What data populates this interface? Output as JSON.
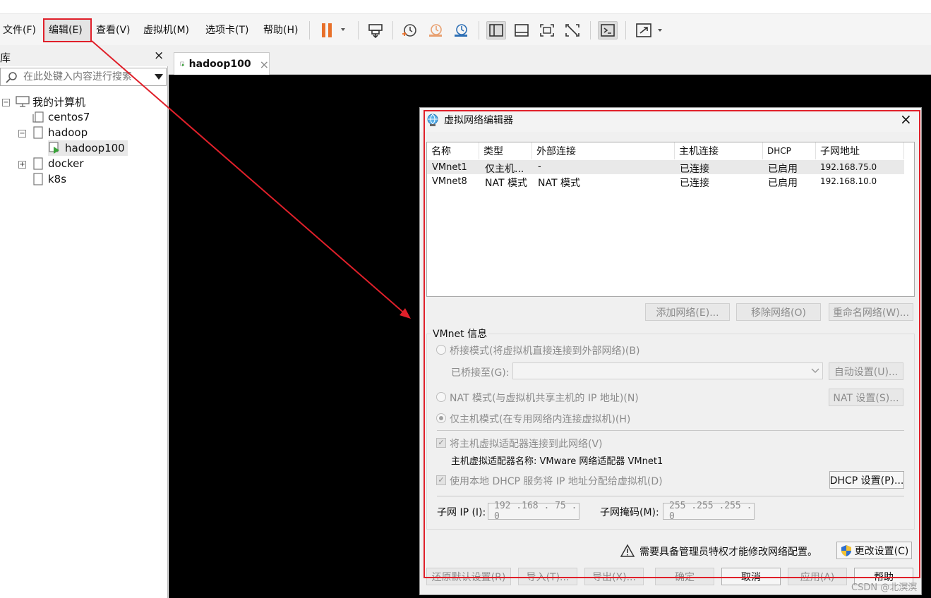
{
  "menu": {
    "file": "文件(F)",
    "edit": "编辑(E)",
    "view": "查看(V)",
    "vm": "虚拟机(M)",
    "tabs": "选项卡(T)",
    "help": "帮助(H)"
  },
  "toolbar": {
    "icons": [
      "pause-icon",
      "send-keys-icon",
      "snapshot-icon",
      "revert-snapshot-icon",
      "snapshot-manager-icon",
      "library-view-icon",
      "thumbnail-view-icon",
      "fullscreen-icon",
      "unity-icon",
      "console-icon",
      "stretch-icon"
    ]
  },
  "sidebar": {
    "title_fragment": "库",
    "close": "×",
    "search_placeholder": "在此处键入内容进行搜索",
    "tree": {
      "root": "我的计算机",
      "items": [
        "centos7",
        "hadoop",
        "hadoop100",
        "docker",
        "k8s"
      ]
    }
  },
  "tab": {
    "label": "hadoop100",
    "close": "×"
  },
  "dialog": {
    "title": "虚拟网络编辑器",
    "close": "×",
    "table": {
      "headers": [
        "名称",
        "类型",
        "外部连接",
        "主机连接",
        "DHCP",
        "子网地址"
      ],
      "rows": [
        [
          "VMnet1",
          "仅主机...",
          "-",
          "已连接",
          "已启用",
          "192.168.75.0"
        ],
        [
          "VMnet8",
          "NAT 模式",
          "NAT 模式",
          "已连接",
          "已启用",
          "192.168.10.0"
        ]
      ]
    },
    "buttons": {
      "add": "添加网络(E)...",
      "remove": "移除网络(O)",
      "rename": "重命名网络(W)..."
    },
    "vmnet_info": {
      "legend": "VMnet 信息",
      "bridged": "桥接模式(将虚拟机直接连接到外部网络)(B)",
      "bridged_to": "已桥接至(G):",
      "auto_settings": "自动设置(U)...",
      "nat": "NAT 模式(与虚拟机共享主机的 IP 地址)(N)",
      "nat_settings": "NAT 设置(S)...",
      "host_only": "仅主机模式(在专用网络内连接虚拟机)(H)",
      "connect_adapter": "将主机虚拟适配器连接到此网络(V)",
      "adapter_name": "主机虚拟适配器名称: VMware 网络适配器 VMnet1",
      "use_dhcp": "使用本地 DHCP 服务将 IP 地址分配给虚拟机(D)",
      "dhcp_settings": "DHCP 设置(P)...",
      "subnet_ip_label": "子网 IP (I):",
      "subnet_ip": "192 .168 . 75  .  0",
      "subnet_mask_label": "子网掩码(M):",
      "subnet_mask": "255 .255 .255 .  0"
    },
    "admin_notice": "需要具备管理员特权才能修改网络配置。",
    "change_settings": "更改设置(C)",
    "footer": {
      "restore": "还原默认设置(R)",
      "import": "导入(T)...",
      "export": "导出(X)...",
      "ok": "确定",
      "cancel": "取消",
      "apply": "应用(A)",
      "help": "帮助"
    }
  },
  "watermark": "CSDN @北溟溟",
  "colors": {
    "annotation_red": "#e0202a",
    "pause_orange": "#e8702a"
  }
}
